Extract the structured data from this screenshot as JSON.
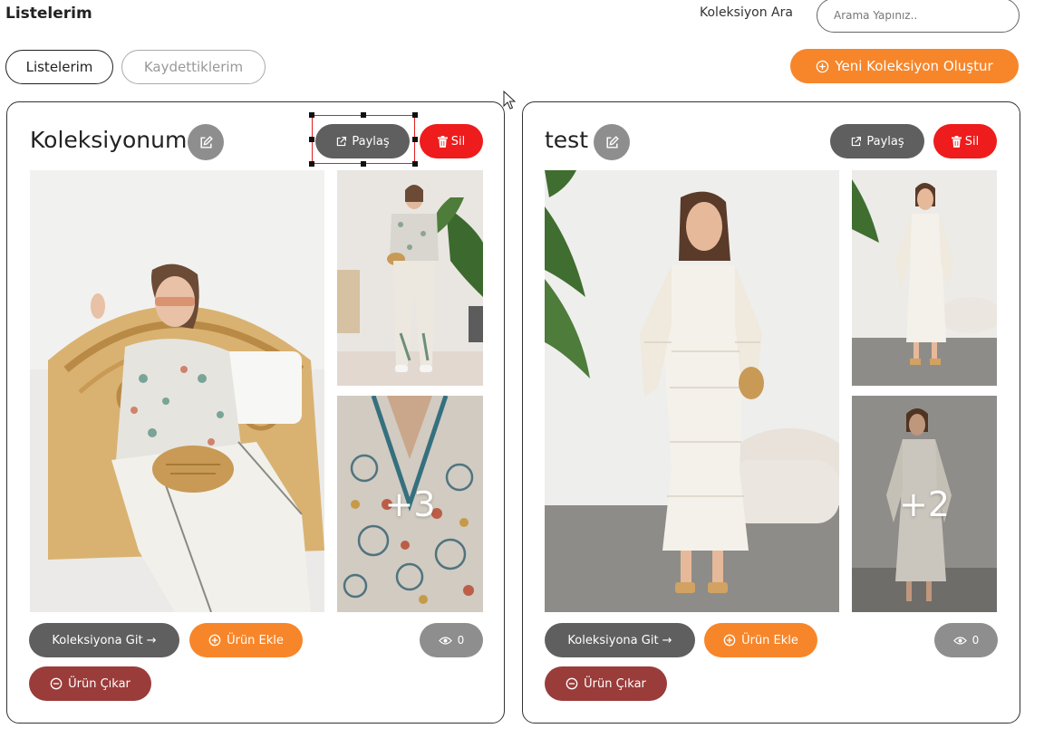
{
  "page": {
    "title": "Listelerim",
    "search_label": "Koleksiyon Ara",
    "search_placeholder": "Arama Yapınız..",
    "search_value": ""
  },
  "tabs": [
    {
      "label": "Listelerim",
      "active": true
    },
    {
      "label": "Kaydettiklerim",
      "active": false
    }
  ],
  "new_collection_label": "Yeni Koleksiyon Oluştur",
  "collections": [
    {
      "title": "Koleksiyonum",
      "share_label": "Paylaş",
      "delete_label": "Sil",
      "more_count": "+3",
      "goto_label": "Koleksiyona Git →",
      "add_label": "Ürün Ekle",
      "remove_label": "Ürün Çıkar",
      "views": "0"
    },
    {
      "title": "test",
      "share_label": "Paylaş",
      "delete_label": "Sil",
      "more_count": "+2",
      "goto_label": "Koleksiyona Git →",
      "add_label": "Ürün Ekle",
      "remove_label": "Ürün Çıkar",
      "views": "0"
    }
  ],
  "colors": {
    "accent_orange": "#f7862a",
    "delete_red": "#ee1c1c",
    "dark_gray": "#5f5f5f",
    "remove_maroon": "#9a3c3a",
    "mid_gray": "#8e8e8e"
  },
  "icons": {
    "edit": "pencil-square-icon",
    "share": "external-link-icon",
    "delete": "trash-icon",
    "add": "plus-circle-icon",
    "remove": "minus-circle-icon",
    "views": "eye-icon",
    "cursor": "mouse-pointer-icon"
  }
}
